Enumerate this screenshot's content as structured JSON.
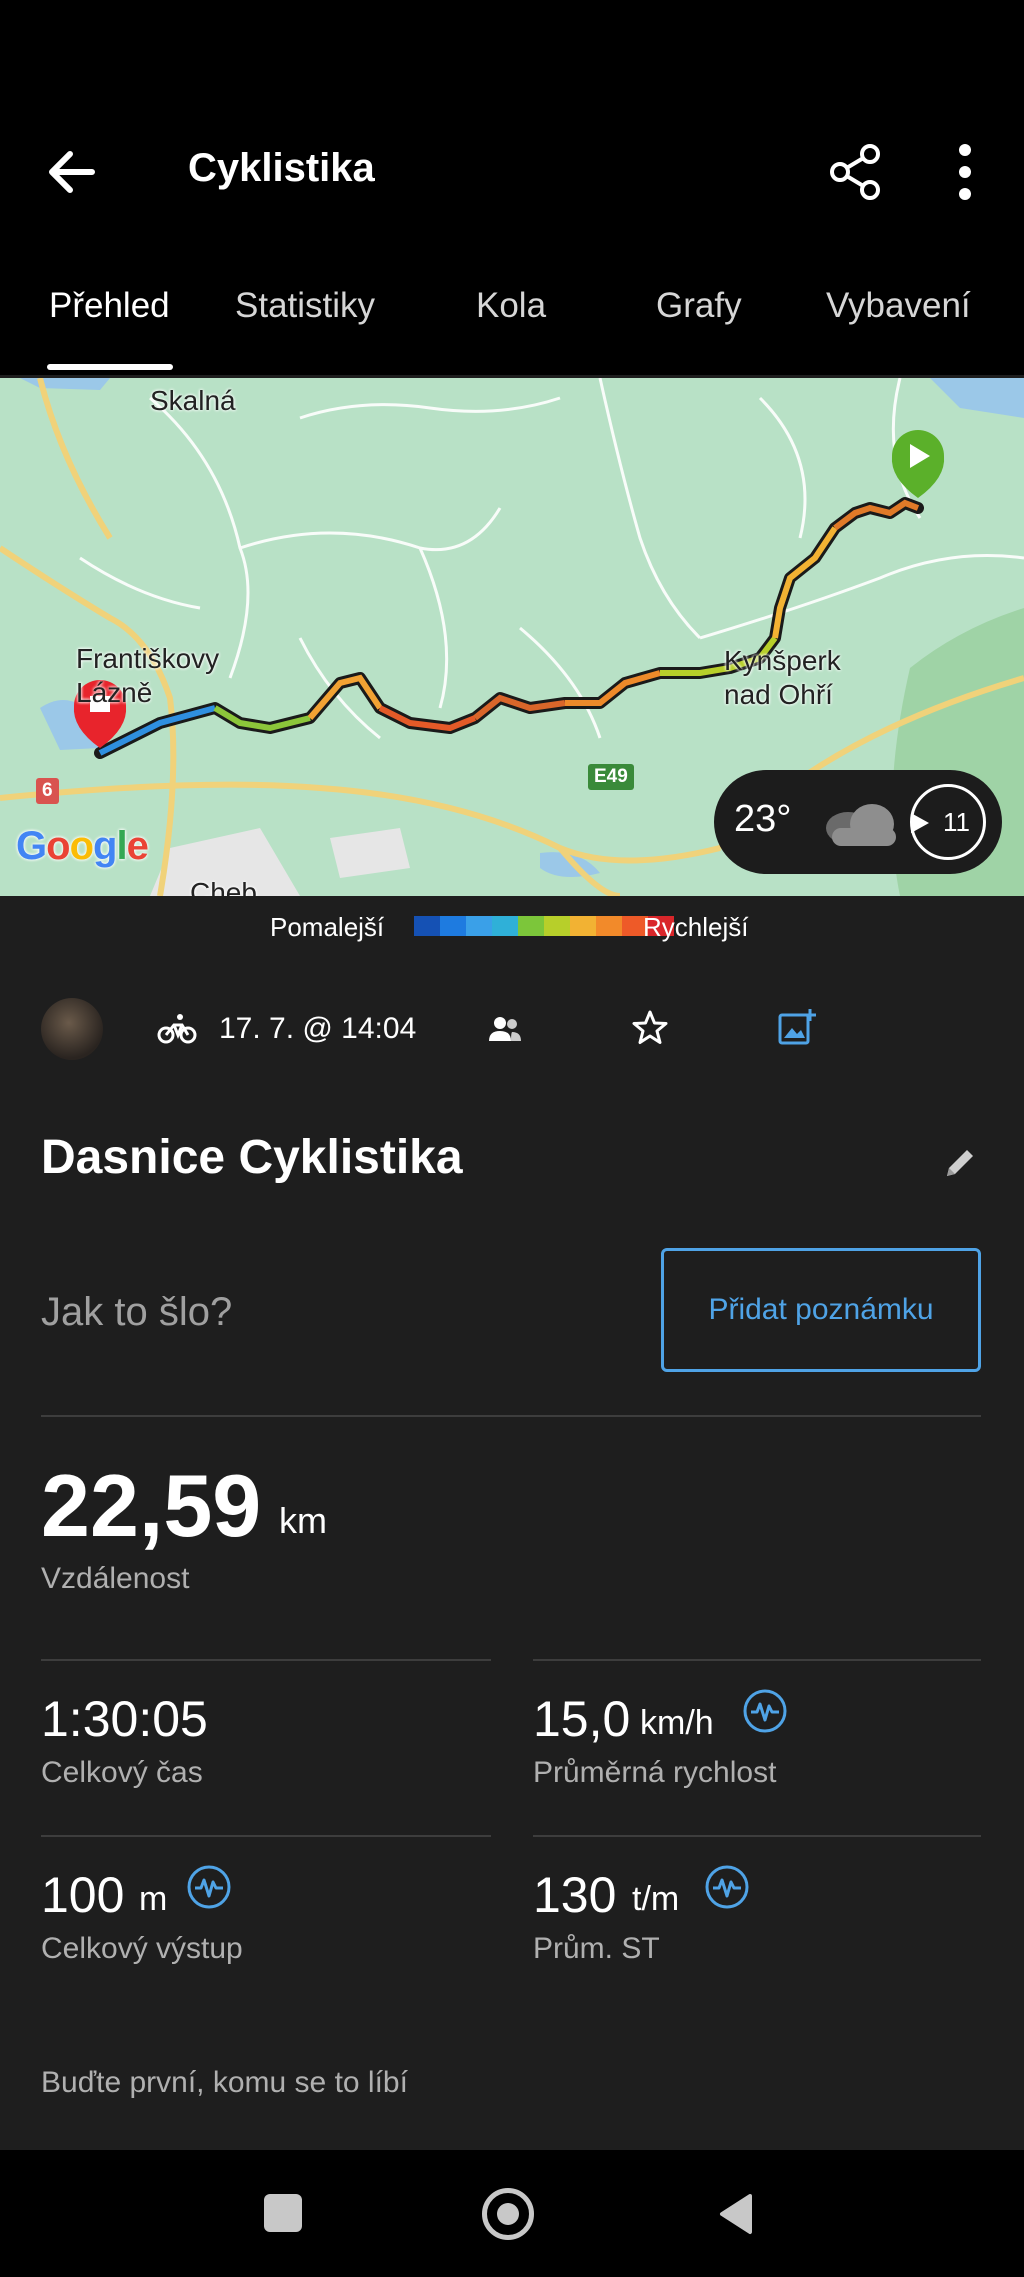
{
  "header": {
    "title": "Cyklistika"
  },
  "tabs": [
    {
      "label": "Přehled",
      "active": true
    },
    {
      "label": "Statistiky"
    },
    {
      "label": "Kola"
    },
    {
      "label": "Grafy"
    },
    {
      "label": "Vybavení"
    }
  ],
  "map": {
    "places": [
      "Skalná",
      "Františkovy Lázně",
      "Kynšperk nad Ohří",
      "Cheb"
    ],
    "road_shields": [
      "6",
      "E49"
    ],
    "attribution": "Google",
    "weather": {
      "temperature": "23°",
      "wind": "11",
      "icon": "cloud-icon"
    }
  },
  "legend": {
    "slower": "Pomalejší",
    "faster": "Rychlejší",
    "colors": [
      "#1551b4",
      "#1e7be0",
      "#3aa0e8",
      "#2fb0d8",
      "#7cc63a",
      "#b7cf2a",
      "#f2b233",
      "#f28a2a",
      "#ee5a28",
      "#d9262a"
    ]
  },
  "meta": {
    "datetime": "17. 7. @ 14:04",
    "activity_icon": "bike-icon"
  },
  "activity": {
    "name": "Dasnice Cyklistika",
    "prompt": "Jak to šlo?",
    "add_note": "Přidat poznámku"
  },
  "distance": {
    "value": "22,59",
    "unit": "km",
    "label": "Vzdálenost"
  },
  "stats": {
    "time": {
      "value": "1:30:05",
      "label": "Celkový čas"
    },
    "avg_speed": {
      "value": "15,0",
      "unit": "km/h",
      "label": "Průměrná rychlost"
    },
    "ascent": {
      "value": "100",
      "unit": "m",
      "label": "Celkový výstup"
    },
    "cadence": {
      "value": "130",
      "unit": "t/m",
      "label": "Prům. ST"
    }
  },
  "likes_text": "Buďte první, komu se to líbí",
  "colors": {
    "accent": "#4fa3e6",
    "background": "#1e1e1e",
    "map_green": "#b8e1c6"
  }
}
